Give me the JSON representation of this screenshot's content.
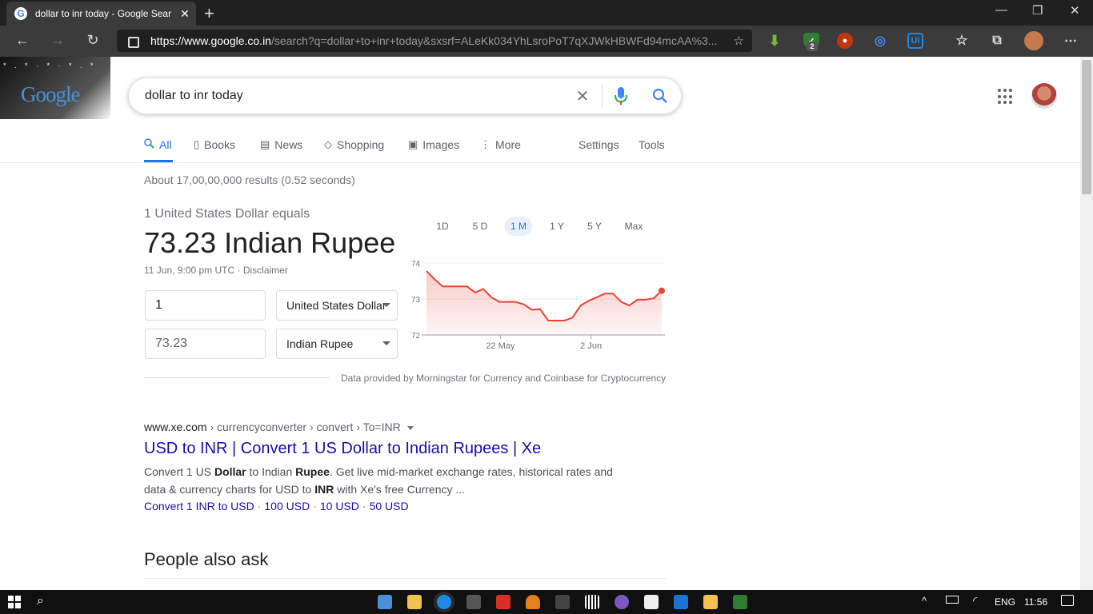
{
  "browser": {
    "tab_title": "dollar to inr today - Google Sear",
    "url_host": "https://www.google.co.in",
    "url_path": "/search?q=dollar+to+inr+today&sxsrf=ALeKk034YhLsroPoT7qXJWkHBWFd94mcAA%3...",
    "extension_badge": "2"
  },
  "search": {
    "logo_text": "Google",
    "query": "dollar to inr today"
  },
  "tabs": {
    "all": "All",
    "books": "Books",
    "news": "News",
    "shopping": "Shopping",
    "images": "Images",
    "more": "More",
    "settings": "Settings",
    "tools": "Tools"
  },
  "result_stats": "About 17,00,00,000 results (0.52 seconds)",
  "currency": {
    "equals_text": "1 United States Dollar equals",
    "value_text": "73.23 Indian Rupee",
    "timestamp": "11 Jun, 9:00 pm UTC · Disclaimer",
    "from_amount": "1",
    "from_currency": "United States Dollar",
    "to_amount": "73.23",
    "to_currency": "Indian Rupee",
    "range_tabs": [
      "1D",
      "5 D",
      "1 M",
      "1 Y",
      "5 Y",
      "Max"
    ],
    "selected_range": "1 M",
    "attribution": "Data provided by Morningstar for Currency and Coinbase for Cryptocurrency"
  },
  "chart_data": {
    "type": "area",
    "ylim": [
      72,
      74
    ],
    "yticks": [
      "74",
      "73",
      "72"
    ],
    "xtick_labels": [
      "22 May",
      "2 Jun"
    ],
    "line_color": "#ea4335",
    "series": [
      {
        "values": [
          73.78,
          73.55,
          73.35,
          73.35,
          73.35,
          73.35,
          73.18,
          73.28,
          73.05,
          72.92,
          72.92,
          72.92,
          72.85,
          72.7,
          72.72,
          72.4,
          72.4,
          72.4,
          72.48,
          72.82,
          72.95,
          73.05,
          73.15,
          73.15,
          72.92,
          72.82,
          72.98,
          72.98,
          73.02,
          73.23
        ]
      }
    ]
  },
  "result": {
    "cite_domain": "www.xe.com",
    "cite_path": " › currencyconverter › convert › To=INR",
    "title": "USD to INR | Convert 1 US Dollar to Indian Rupees | Xe",
    "snippet_1": "Convert 1 US ",
    "snippet_b1": "Dollar",
    "snippet_2": " to Indian ",
    "snippet_b2": "Rupee",
    "snippet_3": ". Get live mid-market exchange rates, historical rates and data & currency charts for USD to ",
    "snippet_b3": "INR",
    "snippet_4": " with Xe's free Currency ...",
    "sitelinks": [
      "Convert 1 INR to USD",
      "100 USD",
      "10 USD",
      "50 USD"
    ]
  },
  "people_also_ask": "People also ask",
  "taskbar": {
    "language": "ENG",
    "time": "11:56"
  }
}
